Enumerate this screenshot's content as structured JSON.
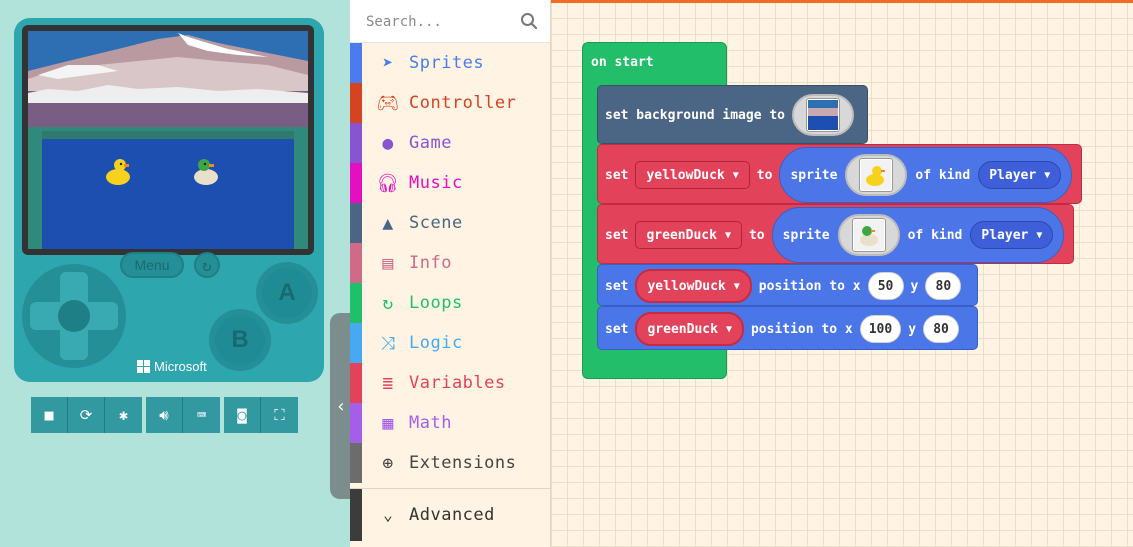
{
  "simulator": {
    "menu_label": "Menu",
    "button_a": "A",
    "button_b": "B",
    "brand": "Microsoft",
    "toolbar": [
      "stop-icon",
      "restart-icon",
      "debug-icon",
      "sound-icon",
      "keyboard-icon",
      "screenshot-icon",
      "fullscreen-icon"
    ]
  },
  "toolbox": {
    "search_placeholder": "Search...",
    "categories": [
      {
        "label": "Sprites",
        "color": "#4b7bec",
        "icon": "paper-plane-icon"
      },
      {
        "label": "Controller",
        "color": "#d54322",
        "icon": "gamepad-icon"
      },
      {
        "label": "Game",
        "color": "#8854d0",
        "icon": "circle-icon"
      },
      {
        "label": "Music",
        "color": "#e30fc0",
        "icon": "headphones-icon"
      },
      {
        "label": "Scene",
        "color": "#4b6584",
        "icon": "tree-icon"
      },
      {
        "label": "Info",
        "color": "#cf6a87",
        "icon": "id-card-icon"
      },
      {
        "label": "Loops",
        "color": "#20bf6b",
        "icon": "loop-icon"
      },
      {
        "label": "Logic",
        "color": "#45aaf2",
        "icon": "shuffle-icon"
      },
      {
        "label": "Variables",
        "color": "#e2435a",
        "icon": "list-icon"
      },
      {
        "label": "Math",
        "color": "#a55eea",
        "icon": "calculator-icon"
      },
      {
        "label": "Extensions",
        "color": "#6c6c6c",
        "icon": "plus-circle-icon"
      }
    ],
    "advanced_label": "Advanced"
  },
  "workspace": {
    "on_start": "on start",
    "set_bg_text": "set background image to",
    "set_word": "set",
    "to_word": "to",
    "sprite_word": "sprite",
    "of_kind": "of kind",
    "position_to_x": "position to x",
    "y_word": "y",
    "yellow_var": "yellowDuck",
    "green_var": "greenDuck",
    "kind": "Player",
    "yellow_x": "50",
    "yellow_y": "80",
    "green_x": "100",
    "green_y": "80",
    "colors": {
      "event": "#23be6a",
      "scene": "#4b6584",
      "sprites": "#4b76e8",
      "variables": "#e2435a"
    }
  }
}
